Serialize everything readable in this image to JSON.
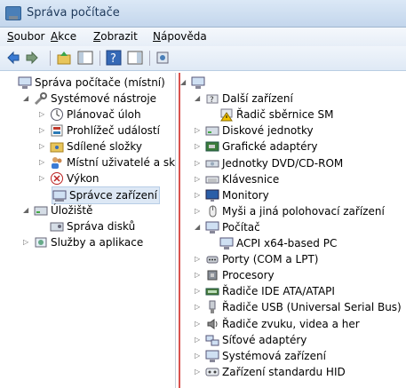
{
  "window": {
    "title": "Správa počítače"
  },
  "menu": {
    "file": {
      "u": "S",
      "rest": "oubor"
    },
    "action": {
      "u": "A",
      "rest": "kce"
    },
    "view": {
      "u": "Z",
      "rest": "obrazit"
    },
    "help": {
      "u": "N",
      "rest": "ápověda"
    }
  },
  "toolbar": [
    "back-arrow-icon",
    "forward-arrow-icon",
    "up-folder-icon",
    "show-hide-tree-icon",
    "help-icon",
    "action-pane-icon",
    "properties-icon"
  ],
  "left_tree": [
    {
      "label": "Správa počítače (místní)",
      "level": 0,
      "icon": "computer-management-icon",
      "expander": ""
    },
    {
      "label": "Systémové nástroje",
      "level": 1,
      "icon": "tools-icon",
      "expander": "◢"
    },
    {
      "label": "Plánovač úloh",
      "level": 2,
      "icon": "clock-icon",
      "expander": "▷"
    },
    {
      "label": "Prohlížeč událostí",
      "level": 2,
      "icon": "event-viewer-icon",
      "expander": "▷"
    },
    {
      "label": "Sdílené složky",
      "level": 2,
      "icon": "shared-folder-icon",
      "expander": "▷"
    },
    {
      "label": "Místní uživatelé a skupiny",
      "level": 2,
      "icon": "users-icon",
      "expander": "▷"
    },
    {
      "label": "Výkon",
      "level": 2,
      "icon": "performance-icon",
      "expander": "▷"
    },
    {
      "label": "Správce zařízení",
      "level": 2,
      "icon": "device-manager-icon",
      "expander": "",
      "selected": true
    },
    {
      "label": "Úložiště",
      "level": 1,
      "icon": "storage-icon",
      "expander": "◢"
    },
    {
      "label": "Správa disků",
      "level": 2,
      "icon": "disk-icon",
      "expander": ""
    },
    {
      "label": "Služby a aplikace",
      "level": 1,
      "icon": "services-icon",
      "expander": "▷"
    }
  ],
  "right_tree": [
    {
      "label": "",
      "level": 0,
      "icon": "computer-icon",
      "expander": "◢"
    },
    {
      "label": "Další zařízení",
      "level": 1,
      "icon": "unknown-device-icon",
      "expander": "◢"
    },
    {
      "label": "Řadič sběrnice SM",
      "level": 2,
      "icon": "warning-device-icon",
      "expander": ""
    },
    {
      "label": "Diskové jednotky",
      "level": 1,
      "icon": "disk-drive-icon",
      "expander": "▷"
    },
    {
      "label": "Grafické adaptéry",
      "level": 1,
      "icon": "display-adapter-icon",
      "expander": "▷"
    },
    {
      "label": "Jednotky DVD/CD-ROM",
      "level": 1,
      "icon": "dvd-icon",
      "expander": "▷"
    },
    {
      "label": "Klávesnice",
      "level": 1,
      "icon": "keyboard-icon",
      "expander": "▷"
    },
    {
      "label": "Monitory",
      "level": 1,
      "icon": "monitor-icon",
      "expander": "▷"
    },
    {
      "label": "Myši a jiná polohovací zařízení",
      "level": 1,
      "icon": "mouse-icon",
      "expander": "▷"
    },
    {
      "label": "Počítač",
      "level": 1,
      "icon": "computer-icon",
      "expander": "◢"
    },
    {
      "label": "ACPI x64-based PC",
      "level": 2,
      "icon": "computer-icon",
      "expander": ""
    },
    {
      "label": "Porty (COM a LPT)",
      "level": 1,
      "icon": "port-icon",
      "expander": "▷"
    },
    {
      "label": "Procesory",
      "level": 1,
      "icon": "processor-icon",
      "expander": "▷"
    },
    {
      "label": "Řadiče IDE ATA/ATAPI",
      "level": 1,
      "icon": "ide-icon",
      "expander": "▷"
    },
    {
      "label": "Řadiče USB (Universal Serial Bus)",
      "level": 1,
      "icon": "usb-icon",
      "expander": "▷"
    },
    {
      "label": "Řadiče zvuku, videa a her",
      "level": 1,
      "icon": "sound-icon",
      "expander": "▷"
    },
    {
      "label": "Síťové adaptéry",
      "level": 1,
      "icon": "network-icon",
      "expander": "▷"
    },
    {
      "label": "Systémová zařízení",
      "level": 1,
      "icon": "system-device-icon",
      "expander": "▷"
    },
    {
      "label": "Zařízení standardu HID",
      "level": 1,
      "icon": "hid-icon",
      "expander": "▷"
    }
  ]
}
